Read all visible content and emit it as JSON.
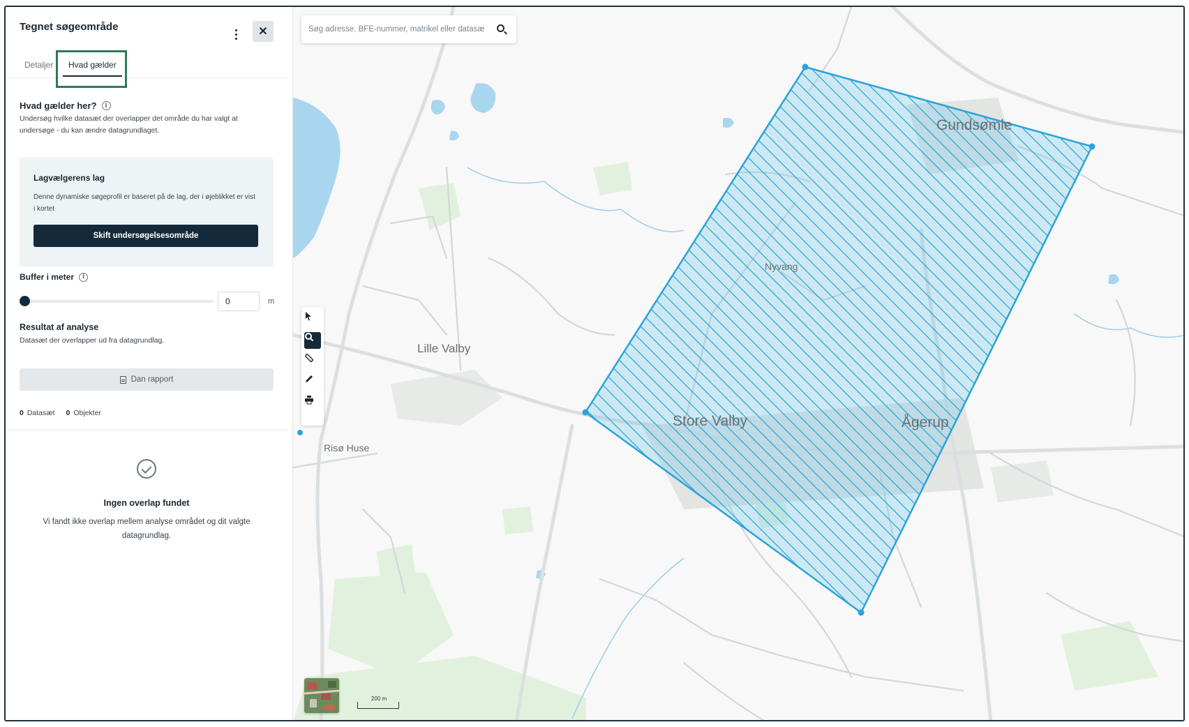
{
  "panel": {
    "title": "Tegnet søgeområde",
    "tabs": [
      {
        "label": "Detaljer",
        "active": false
      },
      {
        "label": "Hvad gælder",
        "active": true
      }
    ],
    "section": {
      "title": "Hvad gælder her?",
      "description": "Undersøg hvilke datasæt der overlapper det område du har valgt at undersøge - du kan ændre datagrundlaget."
    },
    "card": {
      "title": "Lagvælgerens lag",
      "description": "Denne dynamiske søgeprofil er baseret på de lag, der i øjeblikket er vist i kortet",
      "button_label": "Skift undersøgelsesområde"
    },
    "buffer": {
      "title": "Buffer i meter",
      "value": "0",
      "unit": "m",
      "slider_fraction": 0
    },
    "result": {
      "title": "Resultat af analyse",
      "description": "Datasæt der overlapper ud fra datagrundlag.",
      "report_button_label": "Dan rapport",
      "datasets_count": "0",
      "datasets_label": "Datasæt",
      "objects_count": "0",
      "objects_label": "Objekter"
    },
    "empty": {
      "icon": "check-circle-icon",
      "title": "Ingen overlap fundet",
      "description": "Vi fandt ikke overlap mellem analyse området og dit valgte datagrundlag."
    }
  },
  "map": {
    "search_placeholder": "Søg adresse, BFE-nummer, matrikel eller datasæt",
    "tools": [
      "pointer-icon",
      "zoom-icon",
      "measure-icon",
      "draw-icon",
      "print-icon"
    ],
    "active_tool": "zoom-icon",
    "scale_label": "200 m",
    "places": {
      "lille_valby": "Lille Valby",
      "riso_huse": "Risø Huse",
      "store_valby": "Store Valby",
      "agerup": "Ågerup",
      "nyvang": "Nyvang",
      "gundsomagle": "Gundsømle"
    },
    "polygon_color": "#2ba3d9"
  }
}
